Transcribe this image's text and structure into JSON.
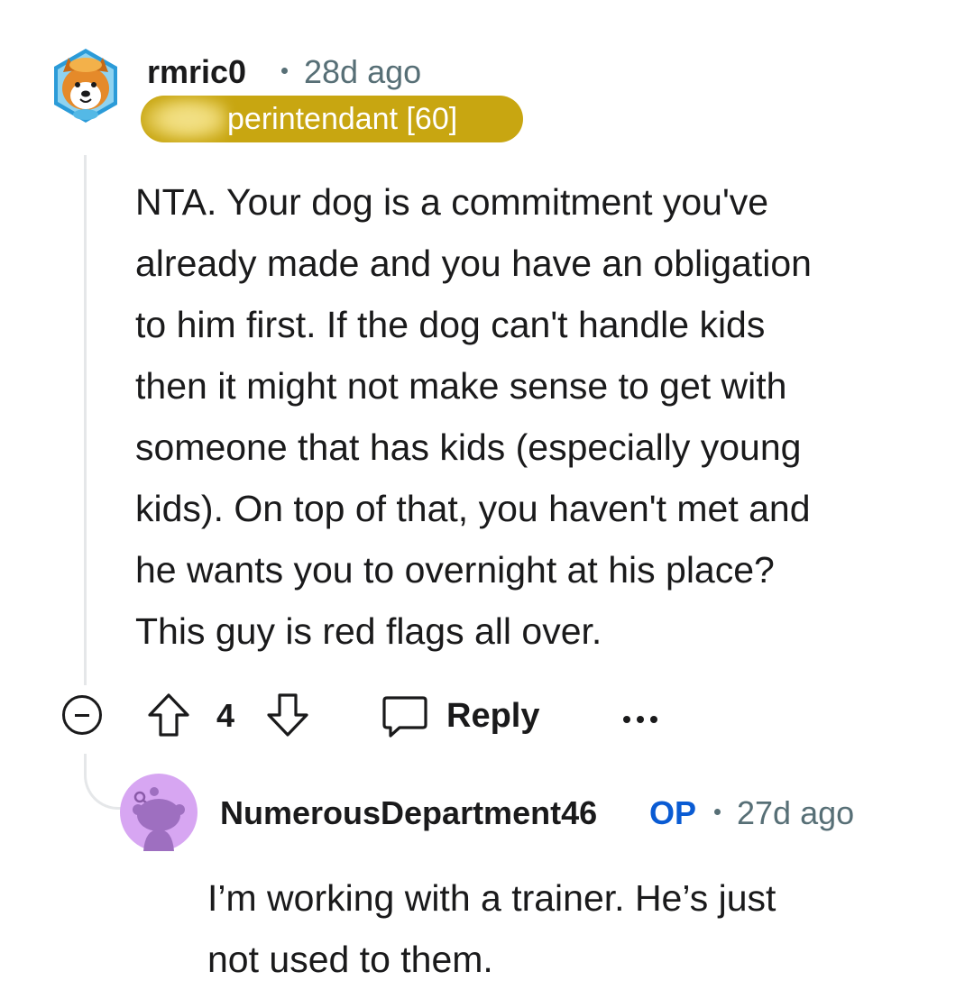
{
  "comment": {
    "author": "rmric0",
    "timestamp": "28d ago",
    "flair": "perintendant [60]",
    "avatar_icon": "dog-avatar-icon",
    "body_lines": [
      "NTA. Your dog is a commitment you've",
      "already made and you have an obligation",
      "to him first. If the dog can't handle kids",
      "then it might not make sense to get with",
      "someone that has kids (especially young",
      "kids). On top of that, you haven't met and",
      "he wants you to overnight at his place?",
      "This guy is red flags all over."
    ],
    "vote_count": "4",
    "reply_label": "Reply"
  },
  "reply": {
    "author": "NumerousDepartment46",
    "op_badge": "OP",
    "timestamp": "27d ago",
    "avatar_icon": "snoo-avatar-icon",
    "body_lines": [
      "I’m working with a trainer. He’s just",
      "not used to them."
    ]
  },
  "colors": {
    "flair_bg": "#c8a611",
    "op_blue": "#0a5bd3",
    "meta_gray": "#576f76",
    "avatar2_bg": "#d7a6f2"
  }
}
